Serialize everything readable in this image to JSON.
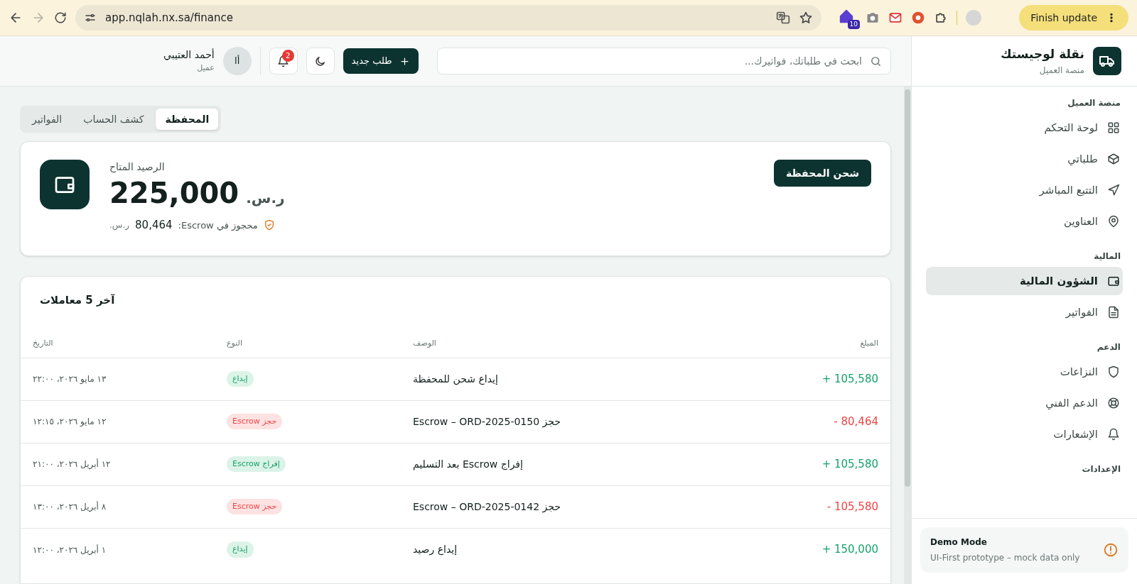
{
  "browser": {
    "url": "app.nqlah.nx.sa/finance",
    "extension_badge": "10",
    "update_button": "Finish update"
  },
  "sidebar": {
    "brand_title": "نقلة لوجيستك",
    "brand_subtitle": "منصة العميل",
    "sections": [
      {
        "title": "منصة العميل",
        "items": [
          {
            "label": "لوحة التحكم",
            "kind": "grid",
            "selected": false
          },
          {
            "label": "طلباتي",
            "kind": "box",
            "selected": false
          },
          {
            "label": "التتبع المباشر",
            "kind": "send",
            "selected": false
          },
          {
            "label": "العناوين",
            "kind": "pin",
            "selected": false
          }
        ]
      },
      {
        "title": "المالية",
        "items": [
          {
            "label": "الشؤون المالية",
            "kind": "wallet",
            "selected": true
          },
          {
            "label": "الفواتير",
            "kind": "file",
            "selected": false
          }
        ]
      },
      {
        "title": "الدعم",
        "items": [
          {
            "label": "النزاعات",
            "kind": "shield",
            "selected": false
          },
          {
            "label": "الدعم الفني",
            "kind": "lifebuoy",
            "selected": false
          },
          {
            "label": "الإشعارات",
            "kind": "bell",
            "selected": false
          }
        ]
      },
      {
        "title": "الإعدادات"
      }
    ],
    "demo": {
      "title": "Demo Mode",
      "text": "UI-First prototype – mock data only"
    }
  },
  "header": {
    "search": {
      "placeholder": "ابحث في طلباتك، فواتيرك..."
    },
    "new_button": "طلب جديد",
    "notification_count": "2",
    "avatar": "أا",
    "user_name": "أحمد العتيبي",
    "user_role": "عميل"
  },
  "tabs": [
    {
      "label": "المحفظة",
      "selected": true
    },
    {
      "label": "كشف الحساب",
      "selected": false
    },
    {
      "label": "الفواتير",
      "selected": false
    }
  ],
  "balance": {
    "label": "الرصيد المتاح",
    "amount": "225,000",
    "currency": "ر.س.",
    "escrow_label": "محجوز في Escrow:",
    "escrow_amount": "80,464",
    "escrow_currency": "ر.س.",
    "topup_button": "شحن المحفظة"
  },
  "table": {
    "title": "آخر 5 معاملات",
    "columns": [
      "المبلغ",
      "الوصف",
      "النوع",
      "التاريخ"
    ],
    "rows": [
      {
        "kind": "credit",
        "amount": "+ 105,580",
        "description": "إيداع شحن للمحفظة",
        "type": "إيداع",
        "date": "١٣ مايو ٢٠٢٦، ٢٢:٠٠"
      },
      {
        "kind": "debit",
        "amount": "- 80,464",
        "description": "حجز Escrow – ORD-2025-0150",
        "type": "حجز Escrow",
        "date": "١٢ مايو ٢٠٢٦، ١٢:١٥"
      },
      {
        "kind": "credit",
        "amount": "+ 105,580",
        "description": "إفراج Escrow بعد التسليم",
        "type": "إفراج Escrow",
        "date": "١٢ أبريل ٢٠٢٦، ٢١:٠٠"
      },
      {
        "kind": "debit",
        "amount": "- 105,580",
        "description": "حجز Escrow – ORD-2025-0142",
        "type": "حجز Escrow",
        "date": "٨ أبريل ٢٠٢٦، ١٣:٠٠"
      },
      {
        "kind": "credit",
        "amount": "+ 150,000",
        "description": "إيداع رصيد",
        "type": "إيداع",
        "date": "١ أبريل ٢٠٢٦، ١٢:٠٠"
      }
    ]
  }
}
